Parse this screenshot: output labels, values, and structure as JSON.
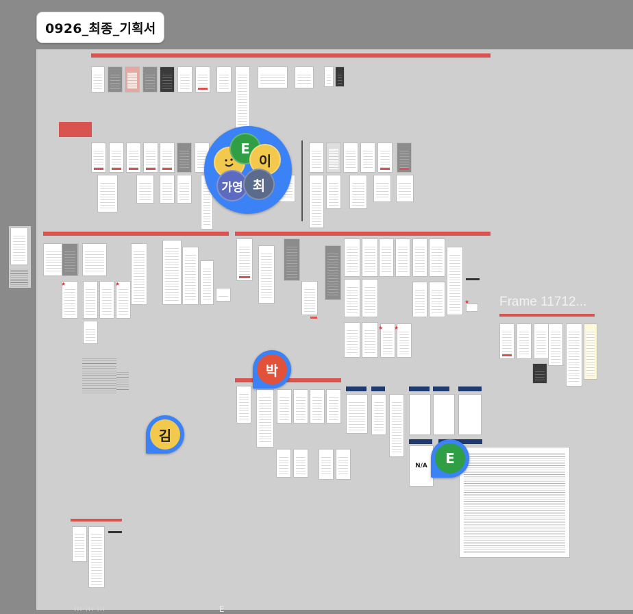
{
  "canvas": {
    "title": "0926_최종_기획서",
    "frame_label": "Frame 11712...",
    "na_label": "N/A",
    "footer_fragment": "E"
  },
  "collaborators": [
    {
      "initial": "E",
      "color": "#2f9e44"
    },
    {
      "initial": "이",
      "color": "#f2c94c"
    },
    {
      "initial": "가영",
      "color": "#5c6bc0"
    },
    {
      "initial": "최",
      "color": "#5b6b8c"
    },
    {
      "initial": "박",
      "color": "#e2513a"
    },
    {
      "initial": "김",
      "color": "#f2c94c"
    },
    {
      "initial": "E",
      "color": "#2f9e44"
    }
  ],
  "colors": {
    "accent_red": "#d9534f",
    "navy": "#1e3a6e",
    "cursor_blue": "#3b82f6",
    "board": "#cfcfcf",
    "canvas_bg": "#8a8a8a"
  }
}
